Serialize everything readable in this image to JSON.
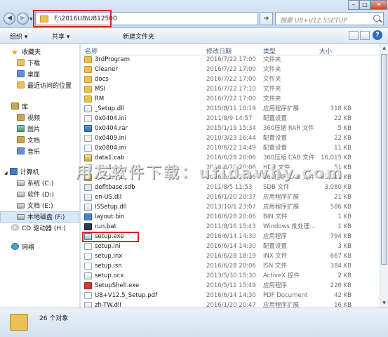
{
  "address": {
    "path": "F:\\2016U8\\U812500"
  },
  "search": {
    "placeholder": "搜索 U8+V12.5SETUP"
  },
  "toolbar": {
    "organize": "组织 ▾",
    "share": "共享 ▾",
    "new_folder": "新建文件夹"
  },
  "nav": {
    "favorites": "收藏夹",
    "downloads": "下载",
    "desktop": "桌面",
    "recent": "最近访问的位置",
    "libraries": "库",
    "videos": "视频",
    "pictures": "图片",
    "documents": "文档",
    "music": "音乐",
    "computer": "计算机",
    "drive_c": "系统 (C:)",
    "drive_d": "软件 (D:)",
    "drive_e": "文档 (E:)",
    "drive_f": "本地磁盘 (F:)",
    "drive_h": "CD 驱动器 (H:)",
    "network": "网络"
  },
  "columns": {
    "name": "名称",
    "date": "修改日期",
    "type": "类型",
    "size": "大小"
  },
  "files": [
    {
      "name": "3rdProgram",
      "date": "2016/7/22 17:00",
      "type": "文件夹",
      "size": ""
    },
    {
      "name": "Cleaner",
      "date": "2016/7/22 17:00",
      "type": "文件夹",
      "size": ""
    },
    {
      "name": "docs",
      "date": "2016/7/22 17:00",
      "type": "文件夹",
      "size": ""
    },
    {
      "name": "MSI",
      "date": "2016/7/22 17:10",
      "type": "文件夹",
      "size": ""
    },
    {
      "name": "RM",
      "date": "2016/7/22 17:00",
      "type": "文件夹",
      "size": ""
    },
    {
      "name": "_Setup.dll",
      "date": "2015/8/11 10:19",
      "type": "应用程序扩展",
      "size": "318 KB"
    },
    {
      "name": "0x0404.ini",
      "date": "2011/8/9 14:57",
      "type": "配置设置",
      "size": "22 KB"
    },
    {
      "name": "0x0404.rar",
      "date": "2015/1/19 15:34",
      "type": "360压缩 RAR 文件",
      "size": "5 KB"
    },
    {
      "name": "0x0409.ini",
      "date": "2010/3/23 16:44",
      "type": "配置设置",
      "size": "22 KB"
    },
    {
      "name": "0x0804.ini",
      "date": "2010/6/22 14:49",
      "type": "配置设置",
      "size": "11 KB"
    },
    {
      "name": "data1.cab",
      "date": "2016/6/28 20:06",
      "type": "360压缩 CAB 文件",
      "size": "16,015 KB"
    },
    {
      "name": "data1.hdr",
      "date": "2016/6/28 20:06",
      "type": "HDR 文件",
      "size": "51 KB"
    },
    {
      "name": "data2.cab",
      "date": "2016/6/28 20:06",
      "type": "360压缩 CAB 文件",
      "size": "53,311 KB"
    },
    {
      "name": "defltbase.sdb",
      "date": "2011/8/5 11:53",
      "type": "SDB 文件",
      "size": "3,080 KB"
    },
    {
      "name": "en-US.dll",
      "date": "2016/1/20 20:37",
      "type": "应用程序扩展",
      "size": "21 KB"
    },
    {
      "name": "ISSetup.dll",
      "date": "2013/10/1 23:07",
      "type": "应用程序扩展",
      "size": "586 KB"
    },
    {
      "name": "layout.bin",
      "date": "2016/6/28 20:06",
      "type": "BIN 文件",
      "size": "1 KB"
    },
    {
      "name": "run.bat",
      "date": "2011/8/16 15:43",
      "type": "Windows 批处理...",
      "size": "1 KB"
    },
    {
      "name": "setup.exe",
      "date": "2016/6/14 14:30",
      "type": "应用程序",
      "size": "794 KB"
    },
    {
      "name": "setup.ini",
      "date": "2016/6/14 14:30",
      "type": "配置设置",
      "size": "3 KB"
    },
    {
      "name": "setup.inx",
      "date": "2016/6/28 18:19",
      "type": "INX 文件",
      "size": "667 KB"
    },
    {
      "name": "setup.isn",
      "date": "2016/6/28 20:06",
      "type": "ISN 文件",
      "size": "384 KB"
    },
    {
      "name": "setup.ocx",
      "date": "2013/5/30 15:30",
      "type": "ActiveX 控件",
      "size": "2 KB"
    },
    {
      "name": "SetupShell.exe",
      "date": "2016/5/11 15:49",
      "type": "应用程序",
      "size": "226 KB"
    },
    {
      "name": "U8+V12.5_Setup.pdf",
      "date": "2016/6/14 14:30",
      "type": "PDF Document",
      "size": "42 KB"
    },
    {
      "name": "zh-TW.dll",
      "date": "2016/1/20 20:47",
      "type": "应用程序扩展",
      "size": "16 KB"
    }
  ],
  "watermark": "用友软件下载：ufidawhy.com",
  "status": {
    "count": "26 个对象"
  }
}
